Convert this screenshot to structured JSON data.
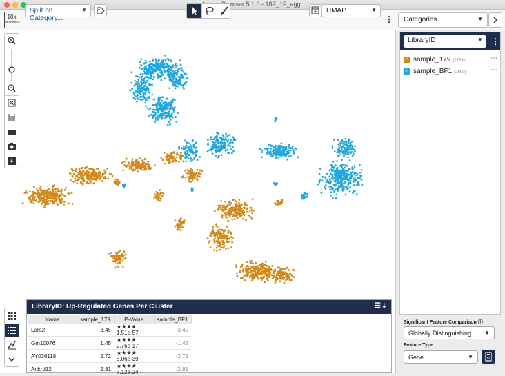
{
  "window": {
    "title": "Loupe Browser 5.1.0 - 18F_1F_aggr"
  },
  "logo": {
    "main": "10x",
    "sub": "GENOMICS"
  },
  "toolbar": {
    "split_label": "Split on Category...",
    "projection_label": "UMAP",
    "categories_label": "Categories"
  },
  "categories_panel": {
    "selected": "LibraryID",
    "items": [
      {
        "label": "sample_179",
        "count": "(2733)",
        "color": "#d08a1c"
      },
      {
        "label": "sample_BF1",
        "count": "(2699)",
        "color": "#23a7dd"
      }
    ],
    "significance_label": "Significant Feature Comparison",
    "significance_value": "Globally Distinguishing",
    "feature_type_label": "Feature Type",
    "feature_type_value": "Gene"
  },
  "table": {
    "title": "LibraryID: Up-Regulated Genes Per Cluster",
    "columns": [
      "Name",
      "sample_179",
      "P-Value",
      "sample_BF1"
    ],
    "rows": [
      {
        "name": "Lars2",
        "v1": "3.45",
        "pval": "★★★★ 1.51e-57",
        "v2": "-3.45"
      },
      {
        "name": "Gm10076",
        "v1": "1.45",
        "pval": "★★★★ 2.76e-17",
        "v2": "-1.45"
      },
      {
        "name": "AY036118",
        "v1": "2.72",
        "pval": "★★★★ 5.06e-39",
        "v2": "-2.72"
      },
      {
        "name": "Ankrd12",
        "v1": "2.81",
        "pval": "★★★★ 7.12e-24",
        "v2": "-2.81"
      }
    ]
  },
  "colors": {
    "sample_179": "#d08a1c",
    "sample_BF1": "#23a7dd",
    "accent": "#1e2d4a"
  }
}
